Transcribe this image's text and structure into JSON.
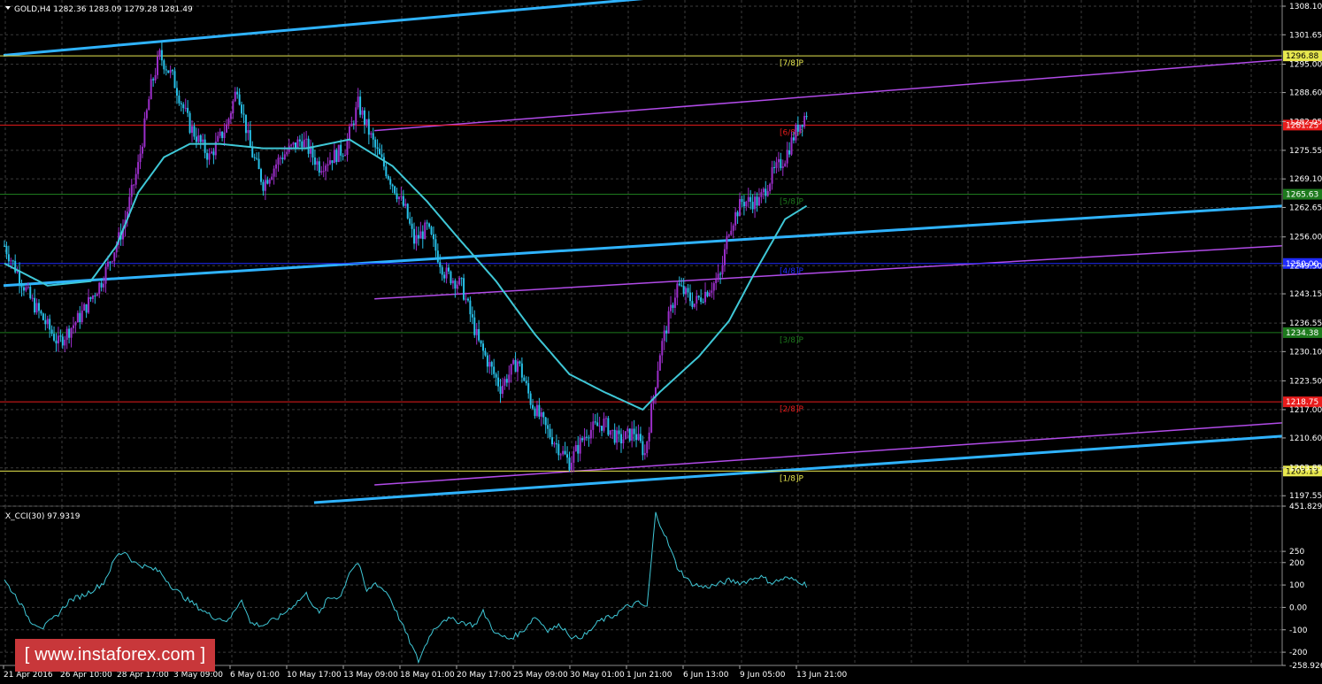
{
  "window": {
    "symbol_header": "GOLD,H4  1282.36 1283.09 1279.28 1281.49",
    "indicator_header": "X_CCI(30) 97.9319"
  },
  "watermark": "[ www.instaforex.com ]",
  "colors": {
    "background": "#000000",
    "grid": "#3b3b3b",
    "bull": "#9b2ec9",
    "bear": "#27c0e8",
    "ma": "#3fc7d6",
    "channel_main": "#2fb3ff",
    "channel_sub": "#b14be8",
    "murrey_yellow": "#e8e84f",
    "murrey_red": "#e81c1c",
    "murrey_green": "#1d7a1d",
    "murrey_blue": "#1f2bff",
    "cci": "#3fc7d6"
  },
  "chart_data": [
    {
      "type": "candlestick",
      "symbol": "GOLD",
      "timeframe": "H4",
      "ohlc_header": {
        "open": 1282.36,
        "high": 1283.09,
        "low": 1279.28,
        "close": 1281.49
      },
      "ylim": [
        1195.2,
        1309.5
      ],
      "y_ticks": [
        "1308.10",
        "1301.65",
        "1295.00",
        "1288.60",
        "1282.05",
        "1275.55",
        "1269.10",
        "1262.65",
        "1256.00",
        "1249.50",
        "1243.15",
        "1236.55",
        "1230.10",
        "1223.50",
        "1217.00",
        "1210.60",
        "1203.85",
        "1197.55"
      ],
      "x_ticks": [
        "21 Apr 2016",
        "26 Apr 10:00",
        "28 Apr 17:00",
        "3 May 09:00",
        "6 May 01:00",
        "10 May 17:00",
        "13 May 09:00",
        "18 May 01:00",
        "20 May 17:00",
        "25 May 09:00",
        "30 May 01:00",
        "1 Jun 21:00",
        "6 Jun 13:00",
        "9 Jun 05:00",
        "13 Jun 21:00"
      ],
      "close_path": [
        [
          0,
          1254
        ],
        [
          12,
          1242
        ],
        [
          25,
          1232
        ],
        [
          35,
          1238
        ],
        [
          45,
          1246
        ],
        [
          55,
          1258
        ],
        [
          62,
          1272
        ],
        [
          68,
          1290
        ],
        [
          72,
          1297
        ],
        [
          78,
          1292
        ],
        [
          86,
          1281
        ],
        [
          95,
          1274
        ],
        [
          103,
          1281
        ],
        [
          108,
          1290
        ],
        [
          114,
          1276
        ],
        [
          120,
          1268
        ],
        [
          128,
          1274
        ],
        [
          138,
          1278
        ],
        [
          146,
          1272
        ],
        [
          158,
          1276
        ],
        [
          164,
          1286
        ],
        [
          172,
          1276
        ],
        [
          178,
          1270
        ],
        [
          186,
          1262
        ],
        [
          190,
          1255
        ],
        [
          196,
          1258
        ],
        [
          204,
          1248
        ],
        [
          212,
          1245
        ],
        [
          220,
          1232
        ],
        [
          230,
          1222
        ],
        [
          238,
          1228
        ],
        [
          244,
          1219
        ],
        [
          252,
          1212
        ],
        [
          262,
          1205
        ],
        [
          270,
          1212
        ],
        [
          278,
          1214
        ],
        [
          285,
          1210
        ],
        [
          292,
          1212
        ],
        [
          297,
          1207
        ],
        [
          304,
          1230
        ],
        [
          312,
          1245
        ],
        [
          320,
          1241
        ],
        [
          328,
          1245
        ],
        [
          332,
          1247
        ],
        [
          336,
          1258
        ],
        [
          342,
          1264
        ],
        [
          350,
          1264
        ],
        [
          356,
          1270
        ],
        [
          362,
          1274
        ],
        [
          368,
          1281
        ],
        [
          372,
          1284
        ],
        [
          374,
          1282
        ]
      ],
      "ma_path": [
        [
          0,
          1250
        ],
        [
          20,
          1245
        ],
        [
          40,
          1246
        ],
        [
          52,
          1254
        ],
        [
          62,
          1266
        ],
        [
          74,
          1274
        ],
        [
          86,
          1277
        ],
        [
          100,
          1277
        ],
        [
          120,
          1276
        ],
        [
          140,
          1276
        ],
        [
          160,
          1278
        ],
        [
          180,
          1272
        ],
        [
          196,
          1264
        ],
        [
          210,
          1256
        ],
        [
          228,
          1246
        ],
        [
          246,
          1234
        ],
        [
          262,
          1225
        ],
        [
          278,
          1221
        ],
        [
          296,
          1217
        ],
        [
          304,
          1221
        ],
        [
          322,
          1229
        ],
        [
          336,
          1237
        ],
        [
          348,
          1248
        ],
        [
          362,
          1260
        ],
        [
          372,
          1263
        ]
      ],
      "channel_lines": [
        {
          "color": "channel_main",
          "from": [
            0,
            1297
          ],
          "to": [
            371,
            1313
          ]
        },
        {
          "color": "channel_main",
          "from": [
            0,
            1245
          ],
          "to": [
            593,
            1263
          ]
        },
        {
          "color": "channel_main",
          "from": [
            144,
            1196
          ],
          "to": [
            593,
            1211
          ]
        },
        {
          "color": "channel_sub",
          "from": [
            172,
            1280
          ],
          "to": [
            593,
            1296
          ]
        },
        {
          "color": "channel_sub",
          "from": [
            172,
            1242
          ],
          "to": [
            593,
            1254
          ]
        },
        {
          "color": "channel_sub",
          "from": [
            172,
            1200
          ],
          "to": [
            593,
            1214
          ]
        }
      ],
      "murrey_levels": [
        {
          "label": "[7/8]P",
          "value": "1296.88",
          "color": "murrey_yellow"
        },
        {
          "label": "[6/8]P",
          "value": "1281.25",
          "color": "murrey_red"
        },
        {
          "label": "[5/8]P",
          "value": "1265.63",
          "color": "murrey_green"
        },
        {
          "label": "[4/8]P",
          "value": "1250.00",
          "color": "murrey_blue"
        },
        {
          "label": "[3/8]P",
          "value": "1234.38",
          "color": "murrey_green"
        },
        {
          "label": "[2/8]P",
          "value": "1218.75",
          "color": "murrey_red"
        },
        {
          "label": "[1/8]P",
          "value": "1203.13",
          "color": "murrey_yellow"
        }
      ]
    },
    {
      "type": "line",
      "name": "X_CCI(30)",
      "last_value": 97.9319,
      "ylim": [
        -258.9265,
        451.8296
      ],
      "y_ticks": [
        "451.8296",
        "250",
        "200",
        "100",
        "0.00",
        "-100",
        "-200",
        "-258.9265"
      ],
      "path": [
        [
          0,
          120
        ],
        [
          6,
          40
        ],
        [
          12,
          -60
        ],
        [
          18,
          -90
        ],
        [
          24,
          -40
        ],
        [
          30,
          30
        ],
        [
          38,
          60
        ],
        [
          46,
          110
        ],
        [
          52,
          230
        ],
        [
          56,
          250
        ],
        [
          60,
          200
        ],
        [
          66,
          180
        ],
        [
          72,
          160
        ],
        [
          78,
          90
        ],
        [
          84,
          40
        ],
        [
          90,
          0
        ],
        [
          96,
          -40
        ],
        [
          104,
          -60
        ],
        [
          110,
          40
        ],
        [
          114,
          -70
        ],
        [
          120,
          -80
        ],
        [
          128,
          -40
        ],
        [
          134,
          10
        ],
        [
          140,
          60
        ],
        [
          146,
          -30
        ],
        [
          150,
          40
        ],
        [
          156,
          50
        ],
        [
          160,
          160
        ],
        [
          164,
          200
        ],
        [
          168,
          70
        ],
        [
          172,
          110
        ],
        [
          178,
          60
        ],
        [
          186,
          -110
        ],
        [
          192,
          -240
        ],
        [
          198,
          -110
        ],
        [
          204,
          -50
        ],
        [
          210,
          -60
        ],
        [
          218,
          -80
        ],
        [
          222,
          -20
        ],
        [
          228,
          -120
        ],
        [
          234,
          -140
        ],
        [
          240,
          -110
        ],
        [
          246,
          -40
        ],
        [
          252,
          -100
        ],
        [
          258,
          -80
        ],
        [
          264,
          -140
        ],
        [
          270,
          -120
        ],
        [
          276,
          -60
        ],
        [
          282,
          -40
        ],
        [
          288,
          0
        ],
        [
          294,
          20
        ],
        [
          298,
          0
        ],
        [
          302,
          420
        ],
        [
          306,
          330
        ],
        [
          312,
          180
        ],
        [
          318,
          110
        ],
        [
          324,
          90
        ],
        [
          330,
          100
        ],
        [
          336,
          120
        ],
        [
          342,
          110
        ],
        [
          350,
          140
        ],
        [
          356,
          110
        ],
        [
          362,
          130
        ],
        [
          368,
          120
        ],
        [
          372,
          100
        ]
      ]
    }
  ]
}
